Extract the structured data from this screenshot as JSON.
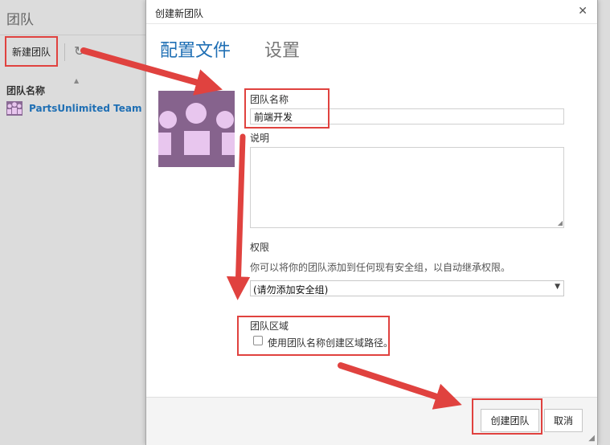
{
  "background": {
    "title": "团队",
    "new_team_button": "新建团队",
    "column_header": "团队名称",
    "team_name": "PartsUnlimited Team"
  },
  "dialog": {
    "title": "创建新团队",
    "tabs": [
      {
        "label": "配置文件",
        "active": true
      },
      {
        "label": "设置",
        "active": false
      }
    ],
    "team_name_label": "团队名称",
    "team_name_value": "前端开发",
    "description_label": "说明",
    "description_value": "",
    "permissions_label": "权限",
    "permissions_help": "你可以将你的团队添加到任何现有安全组，以自动继承权限。",
    "security_group_selected": "(请勿添加安全组)",
    "team_area_label": "团队区域",
    "team_area_checkbox_label": "使用团队名称创建区域路径。",
    "team_area_checked": false,
    "create_button": "创建团队",
    "cancel_button": "取消"
  },
  "icons": {
    "close": "close-icon",
    "refresh": "refresh-icon",
    "dropdown": "chevron-down-icon",
    "avatar": "team-avatar-icon"
  },
  "colors": {
    "accent": "#1f6fb4",
    "annotation": "#e0423f",
    "avatar_bg": "#86638d",
    "avatar_fg": "#e8c6ee"
  }
}
